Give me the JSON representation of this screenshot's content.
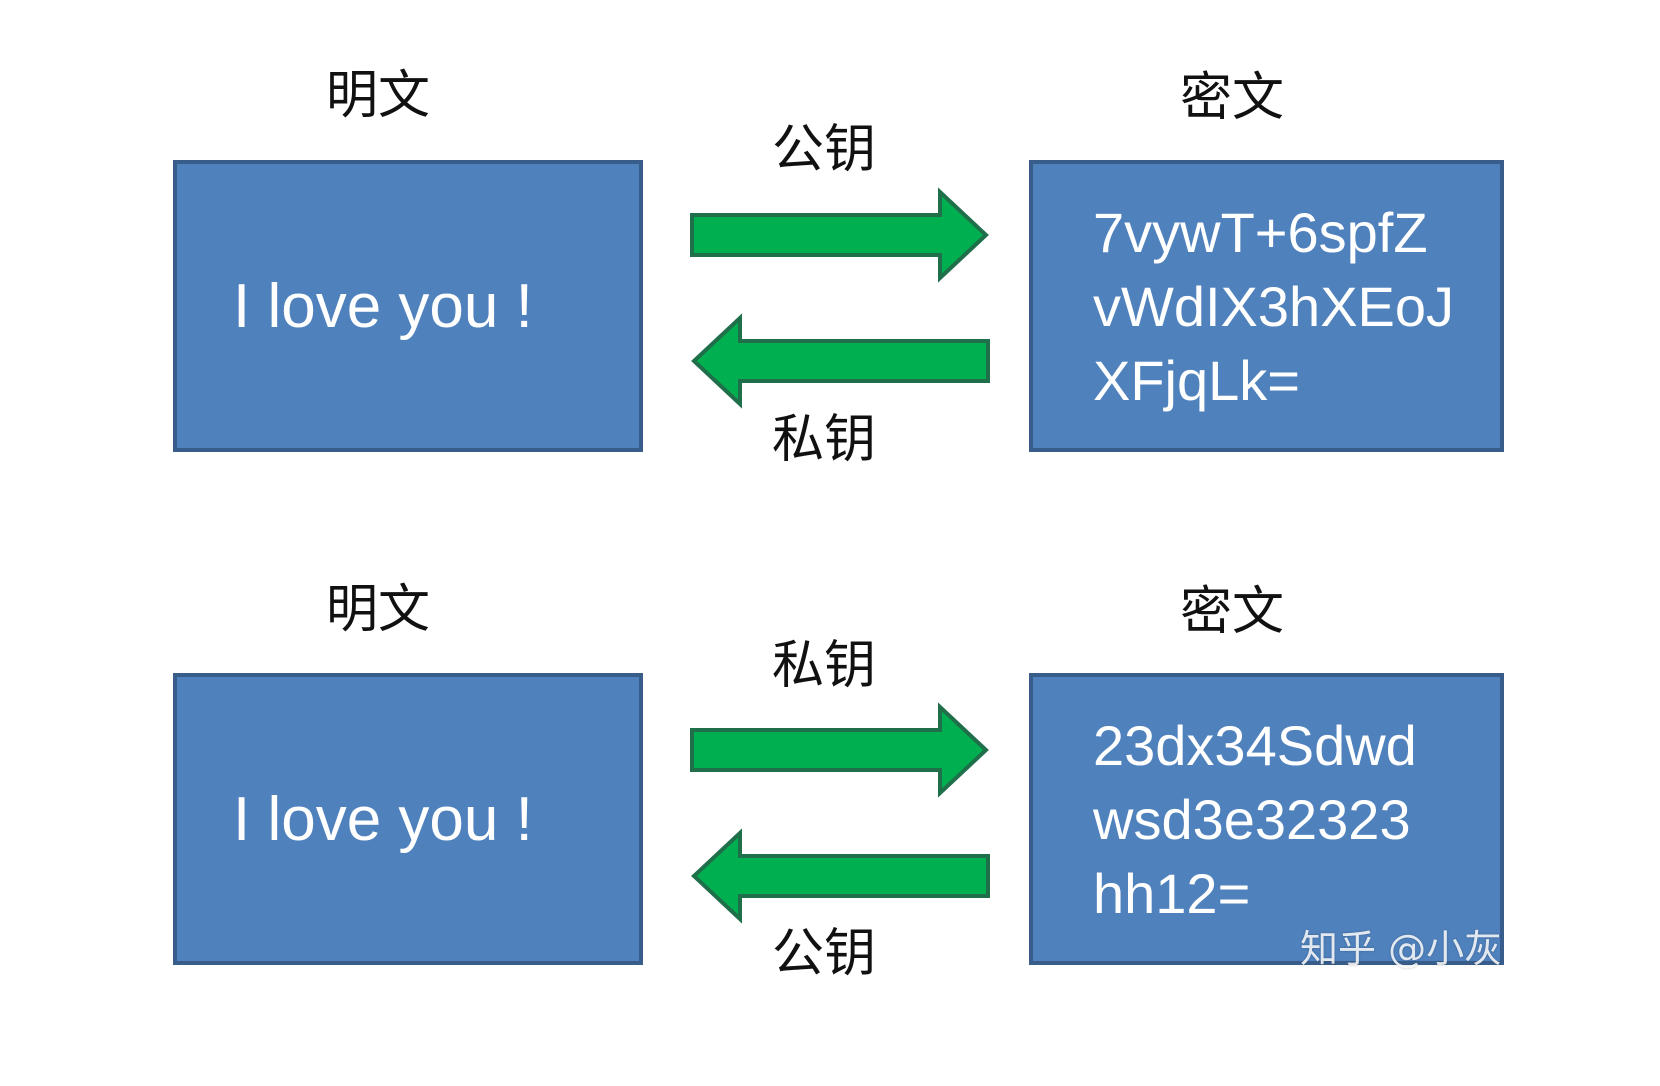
{
  "panels": [
    {
      "plaintext_heading": "明文",
      "ciphertext_heading": "密文",
      "forward_key": "公钥",
      "backward_key": "私钥",
      "plaintext": "I love you !",
      "ciphertext_lines": [
        "7vywT+6spfZ",
        "vWdIX3hXEoJ",
        "XFjqLk="
      ]
    },
    {
      "plaintext_heading": "明文",
      "ciphertext_heading": "密文",
      "forward_key": "私钥",
      "backward_key": "公钥",
      "plaintext": "I love you !",
      "ciphertext_lines": [
        "23dx34Sdwd",
        "wsd3e32323",
        "hh12="
      ]
    }
  ],
  "watermark": "知乎 @小灰",
  "colors": {
    "box_fill": "#4f81bd",
    "box_border": "#385d8a",
    "arrow_fill": "#00b050",
    "arrow_border": "#1f6f4a"
  }
}
